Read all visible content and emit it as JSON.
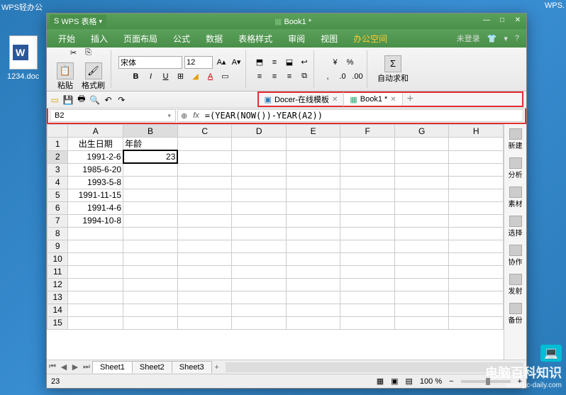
{
  "desktop": {
    "left_label": "WPS轻办公",
    "right_label": "WPS.",
    "file_name": "1234.doc"
  },
  "titlebar": {
    "app_badge": "WPS 表格",
    "document_title": "Book1 *"
  },
  "menubar": {
    "items": [
      "开始",
      "插入",
      "页面布局",
      "公式",
      "数据",
      "表格样式",
      "审阅",
      "视图"
    ],
    "office_space": "办公空间",
    "login": "未登录"
  },
  "ribbon": {
    "paste": "粘贴",
    "format_painter": "格式刷",
    "font_name": "宋体",
    "font_size": "12",
    "auto_sum": "自动求和"
  },
  "doc_tabs": {
    "tab1": "Docer-在线模板",
    "tab2": "Book1 *"
  },
  "formula_bar": {
    "name_box": "B2",
    "formula": "=(YEAR(NOW())-YEAR(A2))"
  },
  "grid": {
    "columns": [
      "A",
      "B",
      "C",
      "D",
      "E",
      "F",
      "G",
      "H"
    ],
    "row_count": 15,
    "header_A": "出生日期",
    "header_B": "年龄",
    "rows": [
      {
        "a": "1991-2-6",
        "b": "23"
      },
      {
        "a": "1985-6-20",
        "b": ""
      },
      {
        "a": "1993-5-8",
        "b": ""
      },
      {
        "a": "1991-11-15",
        "b": ""
      },
      {
        "a": "1991-4-6",
        "b": ""
      },
      {
        "a": "1994-10-8",
        "b": ""
      }
    ]
  },
  "side_panel": {
    "items": [
      "新建",
      "分析",
      "素材",
      "选择",
      "协作",
      "发射",
      "备份"
    ]
  },
  "sheet_tabs": {
    "tabs": [
      "Sheet1",
      "Sheet2",
      "Sheet3"
    ]
  },
  "statusbar": {
    "value": "23",
    "zoom": "100 %"
  },
  "watermark": {
    "title": "电脑百科知识",
    "url": "www.pc-daily.com"
  }
}
